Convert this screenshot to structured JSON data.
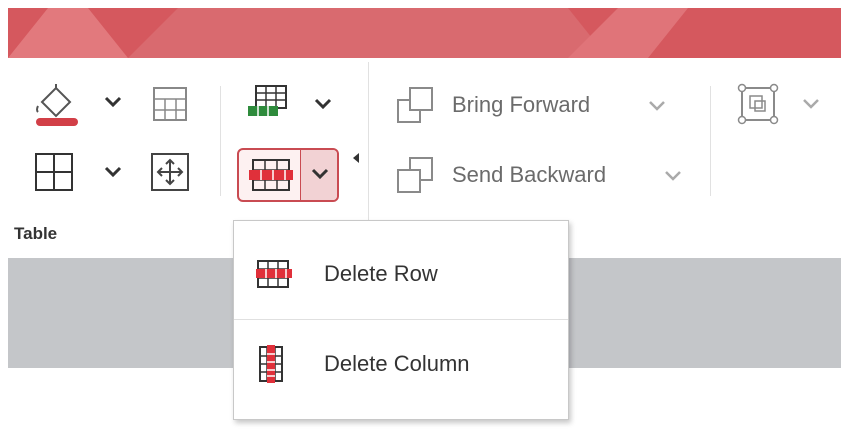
{
  "ribbon": {
    "group_label": "Table",
    "bring_forward_label": "Bring Forward",
    "send_backward_label": "Send Backward"
  },
  "icons": {
    "fill_color": "paint-bucket-icon",
    "borders": "borders-icon",
    "table_layout": "table-grid-icon",
    "move_table": "move-arrows-icon",
    "insert": "insert-row-icon",
    "delete": "delete-row-icon",
    "arrange": "bring-forward-icon",
    "send": "send-backward-icon",
    "shape": "selection-pane-icon"
  },
  "colors": {
    "accent": "#d5585e",
    "fill_underline": "#d23f47",
    "insert_green": "#2e8b3c",
    "delete_red": "#e0303a"
  },
  "dropdown_menu": {
    "items": [
      {
        "label": "Delete Row",
        "icon": "delete-row-icon"
      },
      {
        "label": "Delete Column",
        "icon": "delete-column-icon"
      }
    ]
  }
}
